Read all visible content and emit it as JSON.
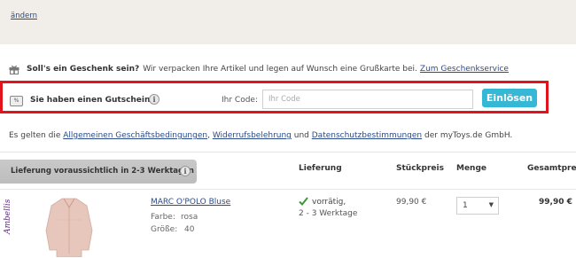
{
  "top": {
    "change_link": "ändern"
  },
  "gift": {
    "title": "Soll's ein Geschenk sein?",
    "text": " Wir verpacken Ihre Artikel und legen auf Wunsch eine Grußkarte bei. ",
    "link": "Zum Geschenkservice"
  },
  "voucher": {
    "percent_icon": "%",
    "question": "Sie haben einen Gutschein?",
    "info_icon": "i",
    "code_label": "Ihr Code:",
    "code_placeholder": "Ihr Code",
    "code_value": "",
    "redeem_label": "Einlösen",
    "accent_color": "#35b8d6",
    "highlight_color": "#e0141a"
  },
  "legal": {
    "prefix": "Es gelten die ",
    "agb": "Allgemeinen Geschäftsbedingungen",
    "sep1": ", ",
    "widerruf": "Widerrufsbelehrung",
    "sep2": " und ",
    "datenschutz": "Datenschutzbestimmungen",
    "suffix": " der myToys.de GmbH."
  },
  "cart": {
    "delivery_tab": "Lieferung voraussichtlich in 2-3 Werktagen",
    "columns": {
      "delivery": "Lieferung",
      "unit_price": "Stückpreis",
      "quantity": "Menge",
      "total": "Gesamtpreis"
    },
    "items": [
      {
        "brand": "Ambellis",
        "name": "MARC O'POLO Bluse",
        "color_label": "Farbe:",
        "color_value": "rosa",
        "size_label": "Größe:",
        "size_value": "40",
        "stock": "vorrätig,",
        "stock_time": "2 - 3 Werktage",
        "unit_price": "99,90 €",
        "quantity": "1",
        "total": "99,90 €"
      }
    ]
  }
}
